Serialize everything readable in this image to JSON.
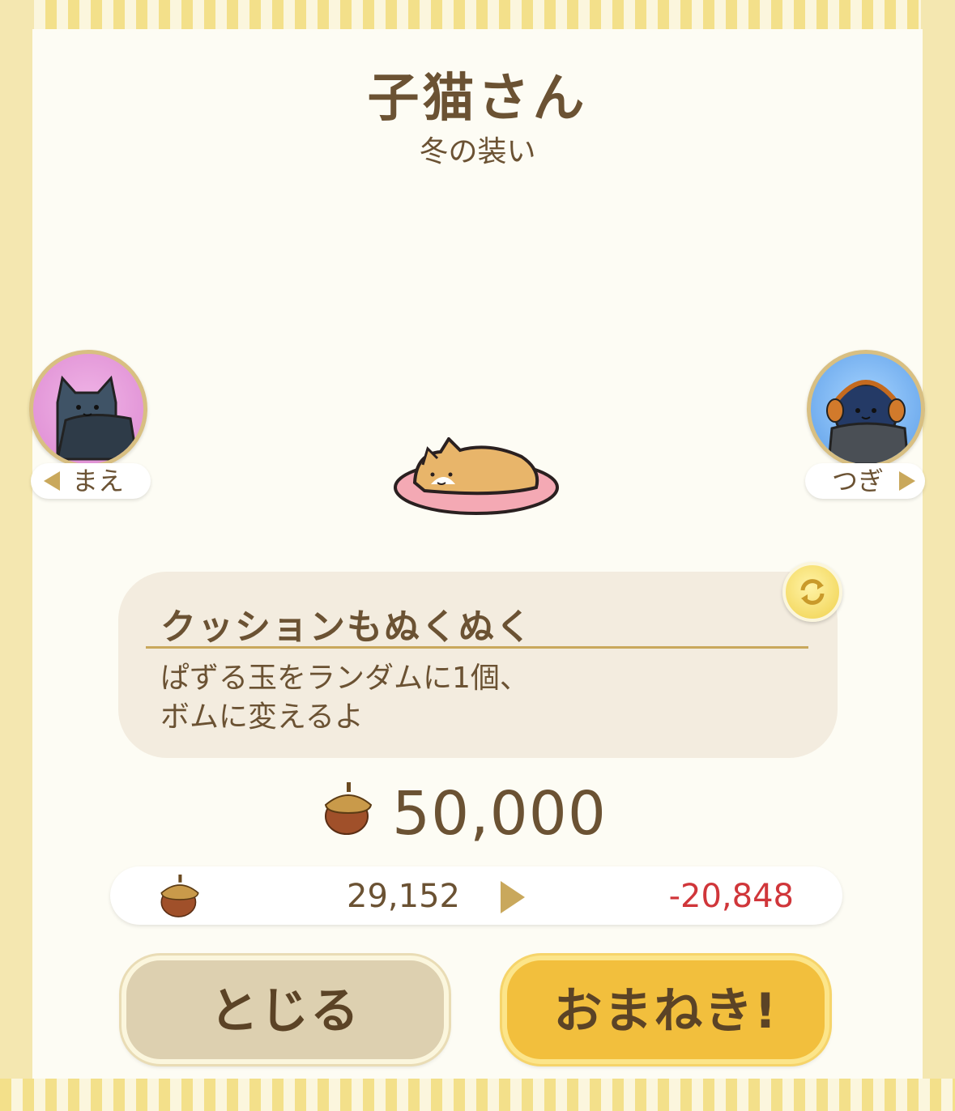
{
  "header": {
    "title": "子猫さん",
    "subtitle": "冬の装い"
  },
  "nav": {
    "prev_label": "まえ",
    "next_label": "つぎ"
  },
  "skill": {
    "name": "クッションもぬくぬく",
    "description_lines": [
      "ぱずる玉をランダムに1個、",
      "ボムに変えるよ"
    ]
  },
  "cost": {
    "currency_icon": "acorn-icon",
    "amount": "50,000"
  },
  "balance": {
    "current": "29,152",
    "difference": "-20,848",
    "difference_color": "#d0363a"
  },
  "buttons": {
    "close_label": "とじる",
    "invite_label": "おまねき!"
  },
  "colors": {
    "text_brown": "#6b5233",
    "invite_button": "#f2bf3d",
    "close_button": "#ddd0b0",
    "accent_gold": "#c9a85c"
  }
}
